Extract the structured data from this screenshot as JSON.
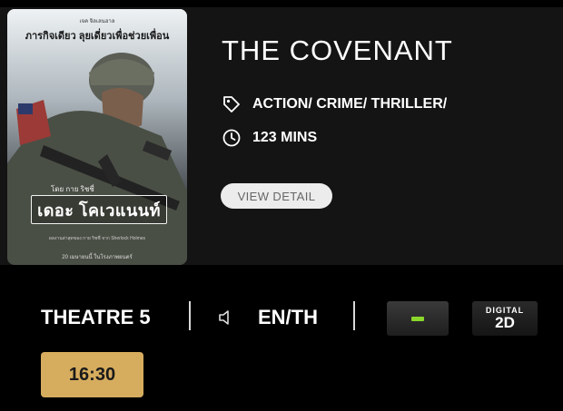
{
  "movie": {
    "title": "THE COVENANT",
    "genre": "ACTION/ CRIME/ THRILLER/",
    "duration": "123 MINS",
    "view_detail_label": "VIEW DETAIL"
  },
  "poster": {
    "credit": "เจค จิลเลนฮาล",
    "tagline": "ภารกิจเดียว ลุยเดี่ยวเพื่อช่วยเพื่อน",
    "by": "โดย กาย ริชชี่",
    "logo_text": "เดอะ โคเวแนนท์",
    "billing": "ผลงานล่าสุดของ กาย ริชชี่ จาก Sherlock Holmes",
    "date": "20 เมษายนนี้ ในโรงภาพยนตร์"
  },
  "showing": {
    "theatre": "THEATRE 5",
    "language": "EN/TH",
    "format_top": "DIGITAL",
    "format_bottom": "2D",
    "times": [
      "16:30"
    ]
  },
  "icons": {
    "genre": "tag-icon",
    "duration": "clock-icon",
    "audio": "speaker-icon",
    "rating": "rating-badge-icon"
  },
  "colors": {
    "background": "#000000",
    "card": "#141414",
    "showtime_button": "#d6ac5e",
    "rating_bar": "#8bd62b",
    "view_detail_button": "#ececec"
  }
}
